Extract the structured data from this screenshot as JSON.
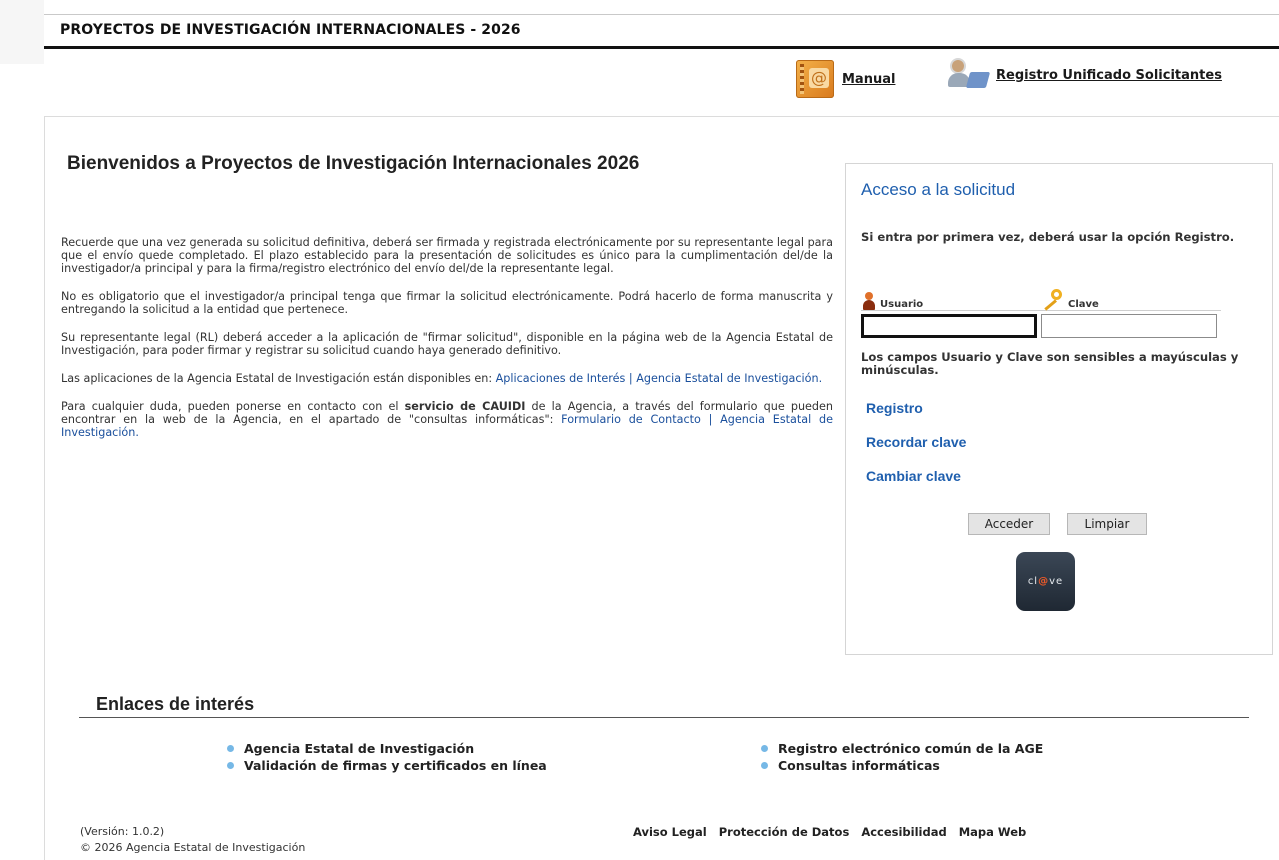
{
  "header": {
    "title": "PROYECTOS DE INVESTIGACIÓN INTERNACIONALES - 2026"
  },
  "top_links": {
    "manual": {
      "label": "Manual",
      "icon": "manual-address-book-icon"
    },
    "registro": {
      "label": "Registro Unificado Solicitantes",
      "icon": "users-icon"
    }
  },
  "main": {
    "title": "Bienvenidos a Proyectos de Investigación Internacionales 2026",
    "paragraphs": {
      "p1": "Recuerde que una vez generada su solicitud definitiva, deberá ser firmada y registrada electrónicamente por su representante legal para que el envío quede completado. El plazo establecido para la presentación de solicitudes es único para la cumplimentación del/de la investigador/a principal y para la firma/registro electrónico del envío del/de la representante legal.",
      "p2": "No es obligatorio que el investigador/a principal tenga que firmar la solicitud electrónicamente. Podrá hacerlo de forma manuscrita y entregando la solicitud a la entidad que pertenece.",
      "p3": "Su representante legal (RL) deberá acceder a la aplicación de \"firmar solicitud\", disponible en la página web de la Agencia Estatal de Investigación, para poder firmar y registrar su solicitud cuando haya generado definitivo.",
      "p4_text": "Las aplicaciones de la Agencia Estatal de Investigación están disponibles en: ",
      "p4_link": "Aplicaciones de Interés | Agencia Estatal de Investigación.",
      "p5_a": "Para cualquier duda, pueden ponerse en contacto con el ",
      "p5_strong": "servicio de CAUIDI",
      "p5_b": " de la Agencia, a través del formulario que pueden encontrar en la web de la Agencia, en el apartado de \"consultas informáticas\": ",
      "p5_link": "Formulario de Contacto | Agencia Estatal de Investigación."
    }
  },
  "login": {
    "title": "Acceso a la solicitud",
    "hint": "Si entra por primera vez, deberá usar la opción Registro.",
    "usuario_label": "Usuario",
    "clave_label": "Clave",
    "usuario_value": "",
    "clave_value": "",
    "case_note": "Los campos Usuario y Clave son sensibles a mayúsculas y minúsculas.",
    "links": {
      "registro": "Registro",
      "recordar": "Recordar clave",
      "cambiar": "Cambiar clave"
    },
    "buttons": {
      "acceder": "Acceder",
      "limpiar": "Limpiar"
    },
    "clave_logo": {
      "pre": "cl",
      "mid": "@",
      "post": "ve"
    }
  },
  "links_section": {
    "title": "Enlaces de interés",
    "left": [
      "Agencia Estatal de Investigación",
      "Validación de firmas y certificados en línea"
    ],
    "right": [
      "Registro electrónico común de la AGE",
      "Consultas informáticas"
    ]
  },
  "footer": {
    "version": "(Versión: 1.0.2)",
    "copyright": "© 2026 Agencia Estatal de Investigación",
    "nav": [
      "Aviso Legal",
      "Protección de Datos",
      "Accesibilidad",
      "Mapa Web"
    ]
  },
  "colors": {
    "link_blue": "#1f5fae",
    "bullet": "#76b8e6",
    "manual_icon": "#e08f2a"
  }
}
